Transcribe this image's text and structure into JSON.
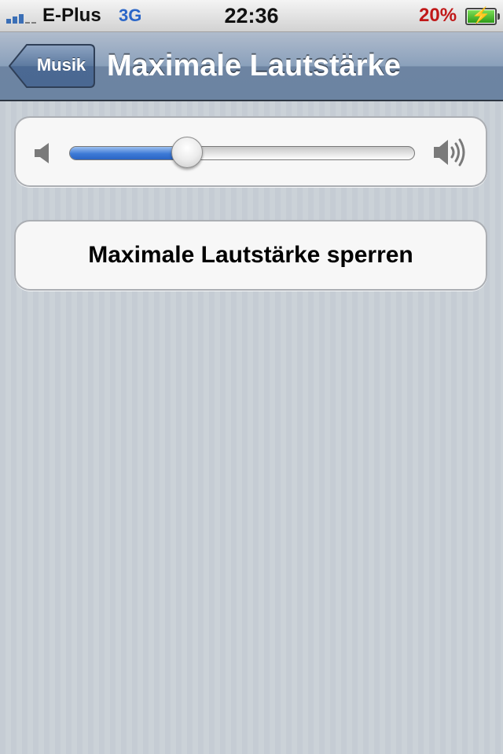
{
  "status_bar": {
    "carrier": "E-Plus",
    "network": "3G",
    "time": "22:36",
    "battery_percent": "20%",
    "signal_bars": 3,
    "icons": [
      "signal-icon",
      "battery-charging-icon"
    ]
  },
  "nav": {
    "back_label": "Musik",
    "title": "Maximale Lautstärke"
  },
  "volume_slider": {
    "value": 0.34,
    "icons": [
      "volume-min-icon",
      "volume-max-icon"
    ],
    "fill_color": "#3d7ad6"
  },
  "lock_button": {
    "label": "Maximale Lautstärke sperren"
  },
  "colors": {
    "nav_bar": "#6d84a2",
    "background": "#c5ccd4",
    "battery_text": "#c01818",
    "network_text": "#2b66c8"
  }
}
